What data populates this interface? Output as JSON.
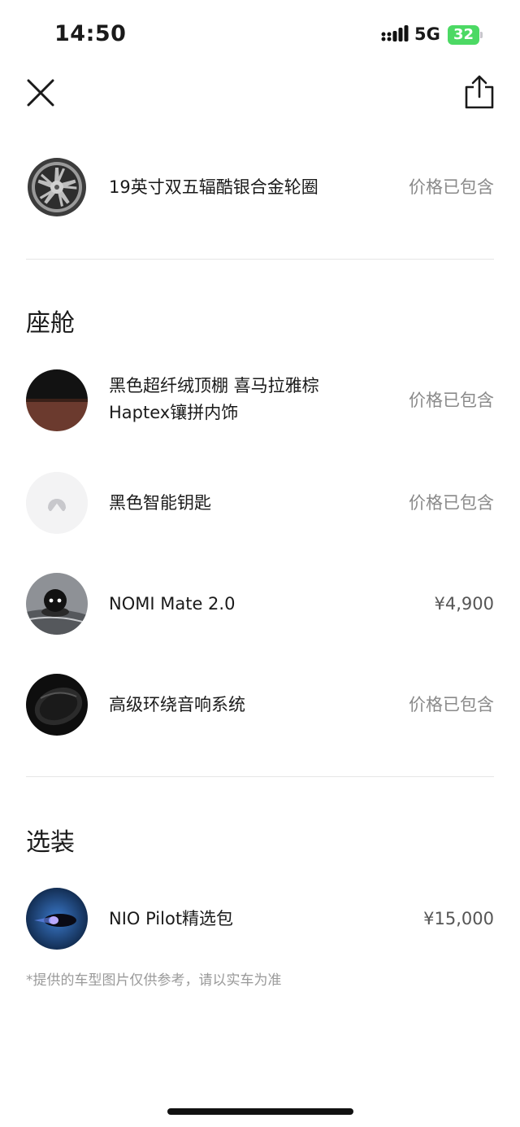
{
  "status_bar": {
    "time": "14:50",
    "network": "5G",
    "battery": "32"
  },
  "toolbar": {
    "close_icon": "close-icon",
    "share_icon": "share-icon"
  },
  "wheel": {
    "label": "19英寸双五辐酷银合金轮圈",
    "price": "价格已包含"
  },
  "cabin": {
    "title": "座舱",
    "items": [
      {
        "label_line1": "黑色超纤绒顶棚 喜马拉雅棕",
        "label_line2": "Haptex镶拼内饰",
        "price": "价格已包含"
      },
      {
        "label": "黑色智能钥匙",
        "price": "价格已包含"
      },
      {
        "label": "NOMI Mate 2.0",
        "price": "¥4,900"
      },
      {
        "label": "高级环绕音响系统",
        "price": "价格已包含"
      }
    ]
  },
  "options": {
    "title": "选装",
    "items": [
      {
        "label": "NIO Pilot精选包",
        "price": "¥15,000"
      }
    ]
  },
  "footnote": "*提供的车型图片仅供参考，请以实车为准",
  "colors": {
    "battery": "#4cd964",
    "price_text": "#8a8a8a",
    "divider": "#e6e6e6"
  }
}
